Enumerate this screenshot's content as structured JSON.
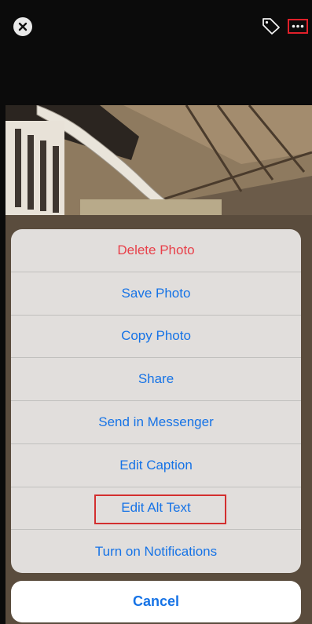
{
  "header": {
    "close_icon": "close-icon",
    "tag_icon": "tag-icon",
    "more_icon": "more-options-icon",
    "more_highlight_color": "#e0202a"
  },
  "action_sheet": {
    "items": [
      {
        "label": "Delete Photo",
        "style": "destructive",
        "color": "#e8404a"
      },
      {
        "label": "Save Photo",
        "style": "default",
        "color": "#1673e6"
      },
      {
        "label": "Copy Photo",
        "style": "default",
        "color": "#1673e6"
      },
      {
        "label": "Share",
        "style": "default",
        "color": "#1673e6"
      },
      {
        "label": "Send in Messenger",
        "style": "default",
        "color": "#1673e6"
      },
      {
        "label": "Edit Caption",
        "style": "default",
        "color": "#1673e6"
      },
      {
        "label": "Edit Alt Text",
        "style": "default",
        "color": "#1673e6",
        "highlighted": true
      },
      {
        "label": "Turn on Notifications",
        "style": "default",
        "color": "#1673e6"
      }
    ],
    "cancel_label": "Cancel"
  }
}
